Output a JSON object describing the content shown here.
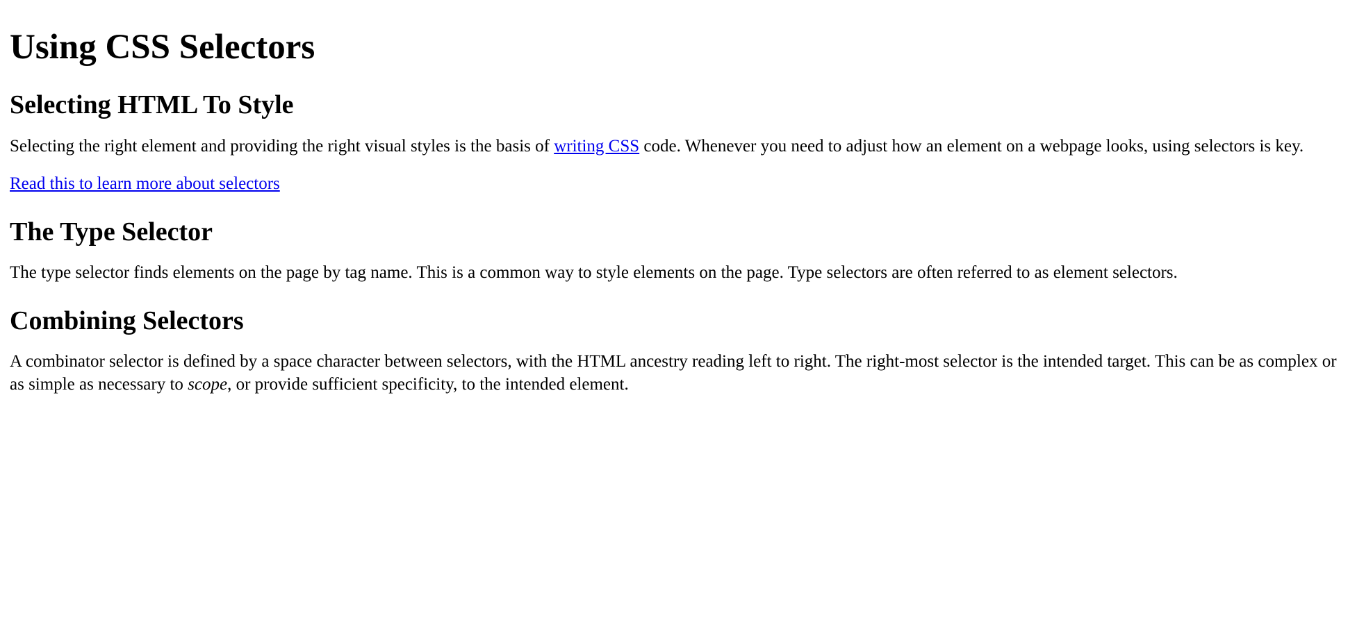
{
  "page": {
    "title": "Using CSS Selectors"
  },
  "section1": {
    "heading": "Selecting HTML To Style",
    "para1_before": "Selecting the right element and providing the right visual styles is the basis of ",
    "para1_link": "writing CSS",
    "para1_after": " code. Whenever you need to adjust how an element on a webpage looks, using selectors is key.",
    "more_link": "Read this to learn more about selectors"
  },
  "section2": {
    "heading": "The Type Selector",
    "para": "The type selector finds elements on the page by tag name. This is a common way to style elements on the page. Type selectors are often referred to as element selectors."
  },
  "section3": {
    "heading": "Combining Selectors",
    "para_before": "A combinator selector is defined by a space character between selectors, with the HTML ancestry reading left to right. The right-most selector is the intended target. This can be as complex or as simple as necessary to ",
    "para_em": "scope",
    "para_after": ", or provide sufficient specificity, to the intended element."
  }
}
